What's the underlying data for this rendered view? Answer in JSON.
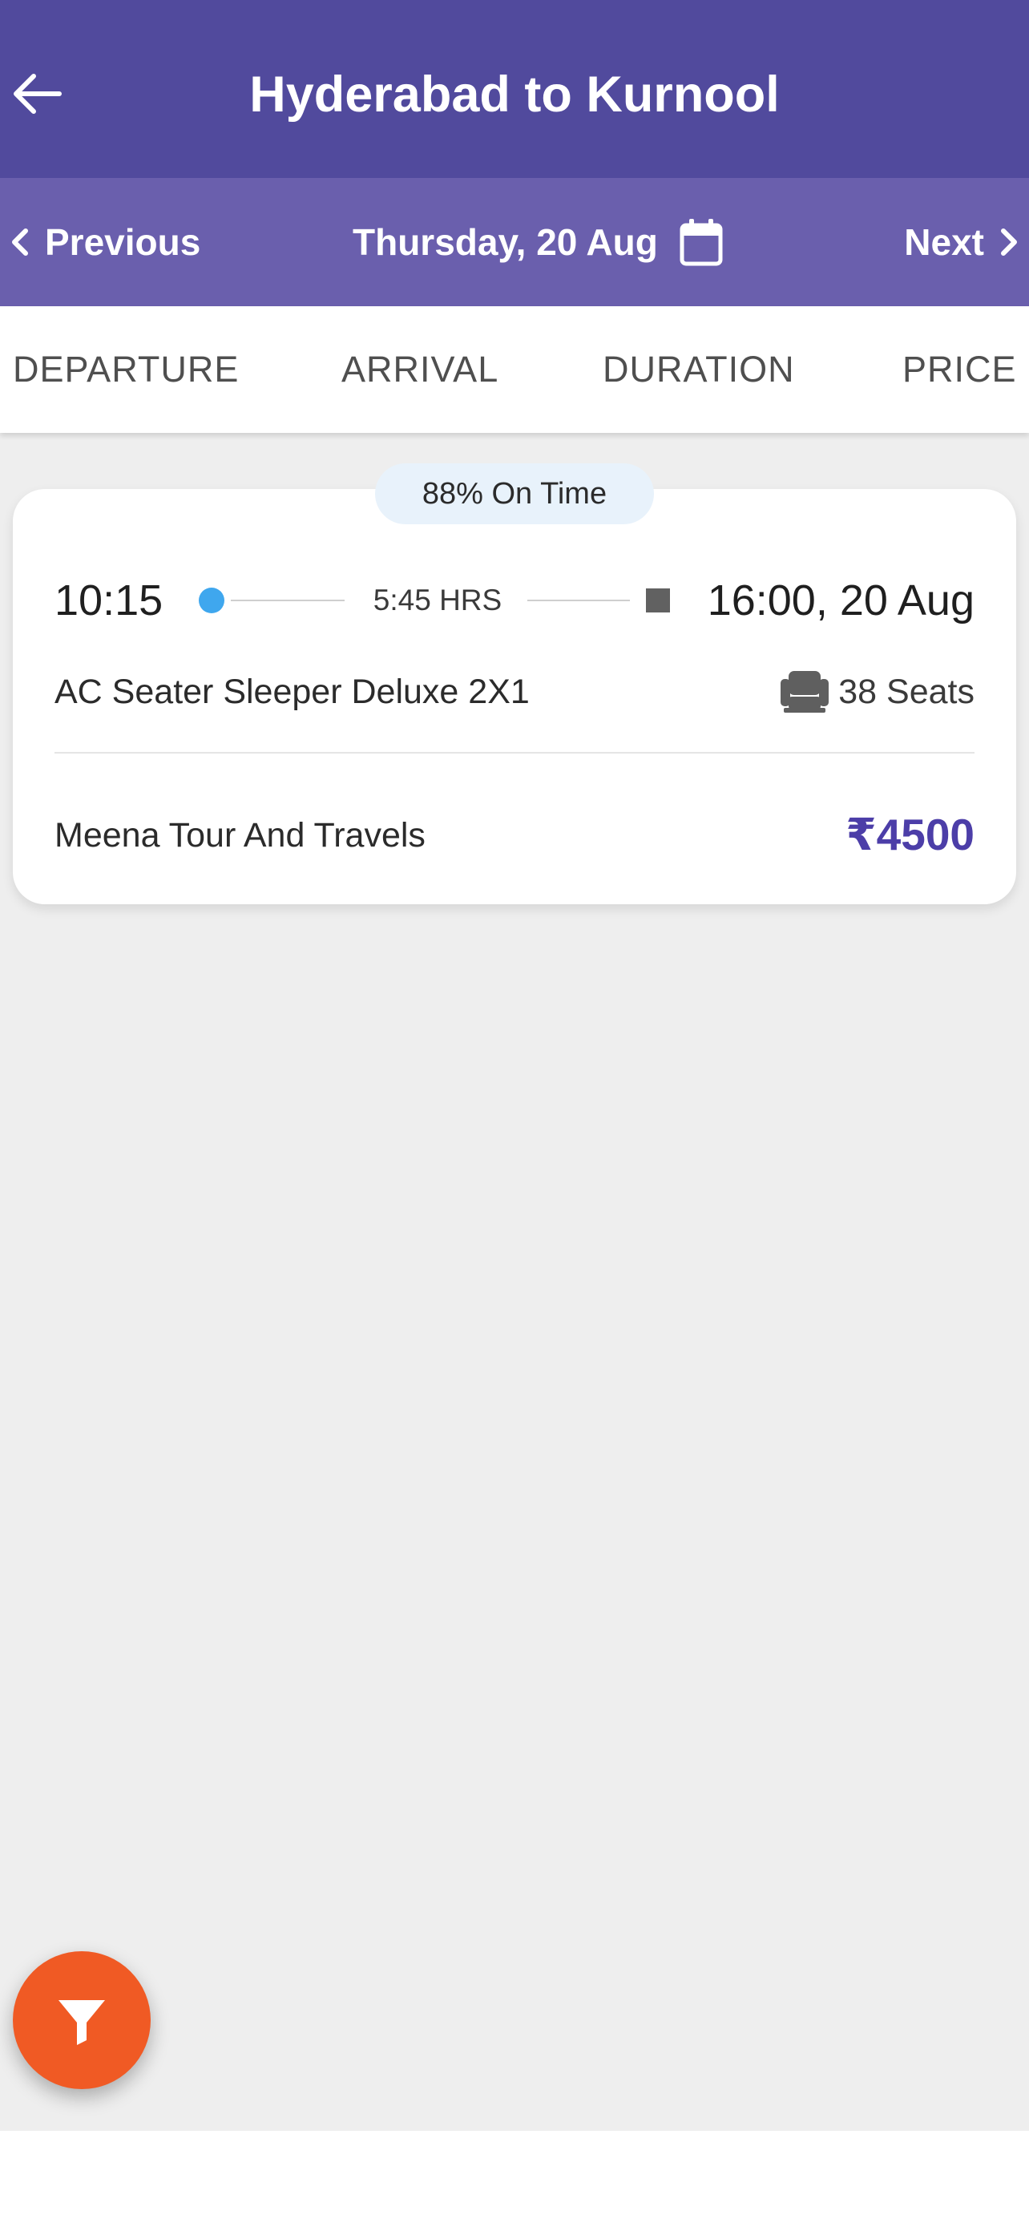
{
  "header": {
    "title": "Hyderabad to Kurnool",
    "back_icon": "arrow-left-icon",
    "background": "#514a9d"
  },
  "date_bar": {
    "previous_label": "Previous",
    "date_label": "Thursday, 20 Aug",
    "next_label": "Next",
    "calendar_icon": "calendar-icon",
    "background": "#6a5fad"
  },
  "sort_tabs": [
    {
      "label": "DEPARTURE"
    },
    {
      "label": "ARRIVAL"
    },
    {
      "label": "DURATION"
    },
    {
      "label": "PRICE"
    }
  ],
  "results": [
    {
      "on_time": "88% On Time",
      "departure_time": "10:15",
      "duration": "5:45 HRS",
      "arrival": "16:00, 20 Aug",
      "bus_type": "AC Seater Sleeper Deluxe 2X1",
      "seats": "38 Seats",
      "operator": "Meena Tour And Travels",
      "price": "₹4500"
    }
  ],
  "colors": {
    "accent": "#4c3ea8",
    "departure_dot": "#3fa7ee",
    "fab": "#f05a24",
    "content_background": "#eeeeee"
  },
  "fab": {
    "icon": "filter-icon"
  }
}
